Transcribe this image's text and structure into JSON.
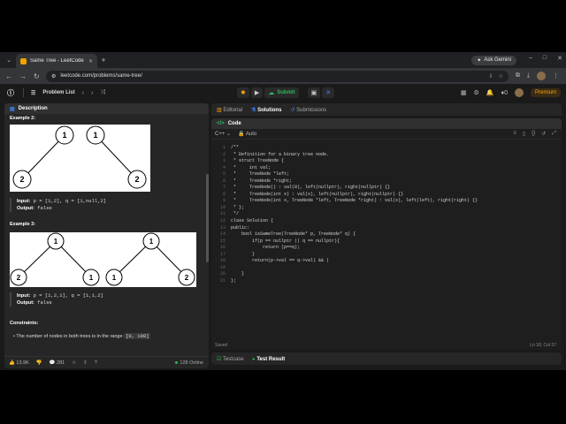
{
  "browser": {
    "tab_title": "Same Tree - LeetCode",
    "url": "leetcode.com/problems/same-tree/",
    "gemini": "Ask Gemini"
  },
  "lcnav": {
    "problem_list": "Problem List",
    "submit": "Submit",
    "premium": "Premium",
    "count": "0"
  },
  "left": {
    "tab": "Description",
    "example2_heading": "Example 2:",
    "example2_input_label": "Input:",
    "example2_input": "p = [1,2], q = [1,null,2]",
    "example2_output_label": "Output:",
    "example2_output": "false",
    "example3_heading": "Example 3:",
    "example3_input_label": "Input:",
    "example3_input": "p = [1,2,1], q = [1,1,2]",
    "example3_output_label": "Output:",
    "example3_output": "false",
    "constraints_heading": "Constraints:",
    "constraint1_text": "The number of nodes in both trees is in the range",
    "constraint1_code": "[0, 100]",
    "tree_nodes": {
      "ex2": [
        "1",
        "1",
        "2",
        "2"
      ],
      "ex3": [
        "1",
        "1",
        "2",
        "1",
        "1",
        "2"
      ]
    },
    "footer": {
      "likes": "13.9K",
      "comments": "281",
      "online": "128 Online"
    }
  },
  "right": {
    "tabs": [
      "Editorial",
      "Solutions",
      "Submissions"
    ],
    "code_tab": "Code",
    "language": "C++",
    "mode": "Auto",
    "code_lines": [
      "/**",
      " * Definition for a binary tree node.",
      " * struct TreeNode {",
      " *     int val;",
      " *     TreeNode *left;",
      " *     TreeNode *right;",
      " *     TreeNode() : val(0), left(nullptr), right(nullptr) {}",
      " *     TreeNode(int x) : val(x), left(nullptr), right(nullptr) {}",
      " *     TreeNode(int x, TreeNode *left, TreeNode *right) : val(x), left(left), right(right) {}",
      " * };",
      " */",
      "class Solution {",
      "public:",
      "    bool isSameTree(TreeNode* p, TreeNode* q) {",
      "        if(p == nullptr || q == nullptr){",
      "            return (p==q);",
      "        }",
      "        return(p->val == q->val) && |",
      "        ",
      "    }",
      "};"
    ],
    "saved": "Saved",
    "cursor_pos": "Ln 18, Col 37",
    "bottom_tabs": [
      "Testcase",
      "Test Result"
    ]
  }
}
